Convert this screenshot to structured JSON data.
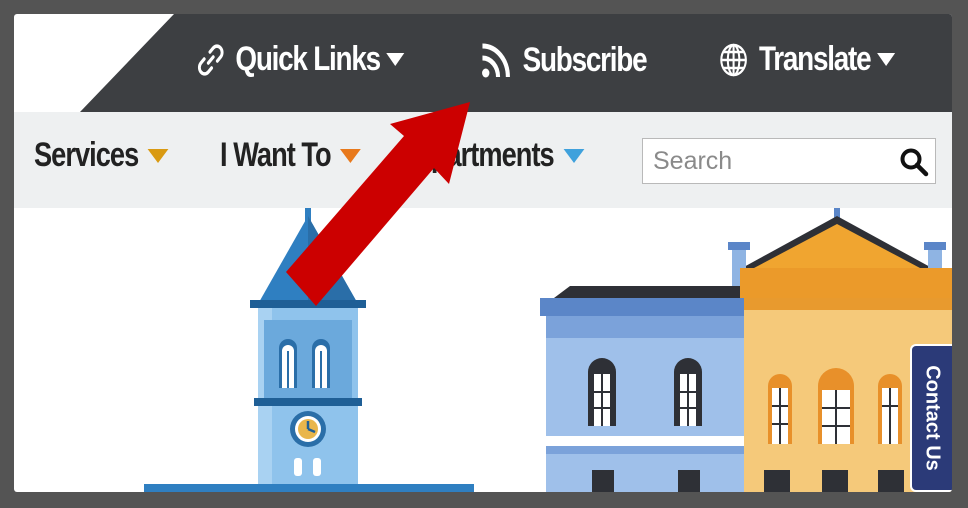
{
  "utility_nav": {
    "quick_links": {
      "label": "Quick Links",
      "icon": "link-icon"
    },
    "subscribe": {
      "label": "Subscribe",
      "icon": "rss-icon"
    },
    "translate": {
      "label": "Translate",
      "icon": "globe-icon"
    }
  },
  "main_nav": {
    "items": [
      {
        "label": "Services",
        "caret_color": "#d99a12"
      },
      {
        "label": "I Want To",
        "caret_color": "#e8791c"
      },
      {
        "label": "Departments",
        "caret_color": "#3fa1dc"
      }
    ]
  },
  "search": {
    "placeholder": "Search",
    "icon": "search-icon"
  },
  "contact_tab": {
    "label": "Contact Us"
  },
  "colors": {
    "topbar": "#3d3f42",
    "navbar": "#eef0f1",
    "arrow": "#cc0000",
    "contact_tab": "#2b3a78"
  }
}
